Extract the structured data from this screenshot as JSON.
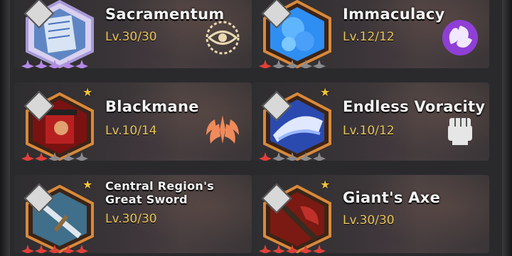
{
  "cards": [
    {
      "name": "Sacramentum",
      "level": "Lv.30/30",
      "type_icon": "eye-sigil-icon",
      "star_color": "purple",
      "stars_filled": 5,
      "hex_color": "#c8bfe8",
      "art_color": "#6a8ec8"
    },
    {
      "name": "Immaculacy",
      "level": "Lv.12/12",
      "type_icon": "spiral-orb-icon",
      "star_color": "red",
      "stars_filled": 1,
      "hex_color": "#d9893a",
      "art_color": "#2f8ef2"
    },
    {
      "name": "Blackmane",
      "level": "Lv.10/14",
      "type_icon": "flame-wings-icon",
      "star_color": "red",
      "stars_filled": 2,
      "hex_color": "#d9893a",
      "art_color": "#8a1a1a"
    },
    {
      "name": "Endless Voracity",
      "level": "Lv.10/12",
      "type_icon": "fist-icon",
      "star_color": "red",
      "stars_filled": 1,
      "hex_color": "#d9893a",
      "art_color": "#3a6ad8"
    },
    {
      "name_lines": [
        "Central Region's",
        "Great Sword"
      ],
      "level": "Lv.30/30",
      "type_icon": "",
      "star_color": "red",
      "stars_filled": 5,
      "hex_color": "#d9893a",
      "art_color": "#3f6f8a"
    },
    {
      "name": "Giant's Axe",
      "level": "Lv.30/30",
      "type_icon": "",
      "star_color": "red",
      "stars_filled": 5,
      "hex_color": "#d9893a",
      "art_color": "#7a1a12"
    }
  ],
  "colors": {
    "level_text": "#e8c45a",
    "star_badge": "#f3c43a",
    "eye_icon": "#e8d9b0",
    "spiral_icon": "#8f3fd6",
    "flame_icon": "#f08a5a",
    "fist_icon": "#e6e6e6"
  }
}
